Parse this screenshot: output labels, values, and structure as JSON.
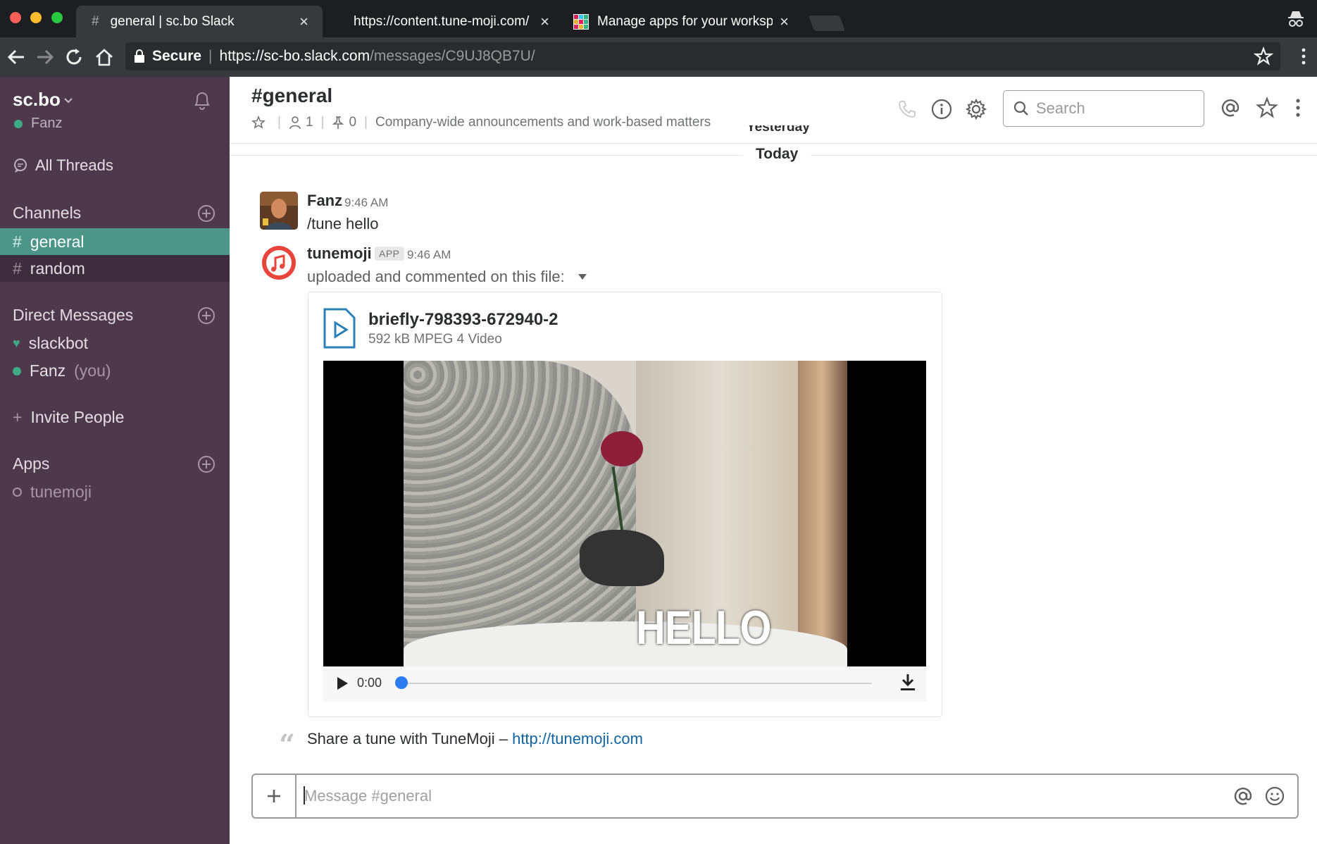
{
  "browser": {
    "tabs": [
      {
        "label": "general | sc.bo Slack",
        "favicon": "hash",
        "active": true
      },
      {
        "label": "https://content.tune-moji.com/",
        "favicon": "none",
        "active": false
      },
      {
        "label": "Manage apps for your workspa",
        "favicon": "slack-grid",
        "active": false
      }
    ],
    "tab_close": "×",
    "tab_hash": "#",
    "secure_label": "Secure",
    "separator": "|",
    "url_host": "https://sc-bo.slack.com",
    "url_path": "/messages/C9UJ8QB7U/"
  },
  "sidebar": {
    "team_name": "sc.bo",
    "user_name": "Fanz",
    "all_threads": "All Threads",
    "channels_heading": "Channels",
    "channels": [
      {
        "name": "general",
        "active": true
      },
      {
        "name": "random",
        "active": false
      }
    ],
    "hash": "#",
    "dm_heading": "Direct Messages",
    "dms": [
      {
        "name": "slackbot",
        "suffix": ""
      },
      {
        "name": "Fanz",
        "suffix": "(you)"
      }
    ],
    "invite": "Invite People",
    "invite_plus": "+",
    "apps_heading": "Apps",
    "apps": [
      {
        "name": "tunemoji"
      }
    ],
    "colors": {
      "bg": "#4d394b",
      "active": "#4c9689",
      "presence": "#3daa83"
    }
  },
  "channel": {
    "title": "#general",
    "members": "1",
    "pins": "0",
    "purpose": "Company-wide announcements and work-based matters",
    "search_placeholder": "Search"
  },
  "messages": {
    "yesterday_label": "Yesterday",
    "today_label": "Today",
    "items": [
      {
        "author": "Fanz",
        "time": "9:46 AM",
        "text": "/tune hello"
      },
      {
        "author": "tunemoji",
        "badge": "APP",
        "time": "9:46 AM",
        "text": "uploaded and commented on this file:"
      }
    ],
    "file": {
      "name": "briefly-798393-672940-2",
      "meta": "592 kB MPEG 4 Video",
      "video_caption": "HELLO",
      "current_time": "0:00",
      "progress": 0
    },
    "attachment": {
      "quote": "“",
      "text": "Share a tune with TuneMoji –",
      "link": "http://tunemoji.com"
    }
  },
  "composer": {
    "placeholder": "Message #general",
    "plus": "+"
  }
}
